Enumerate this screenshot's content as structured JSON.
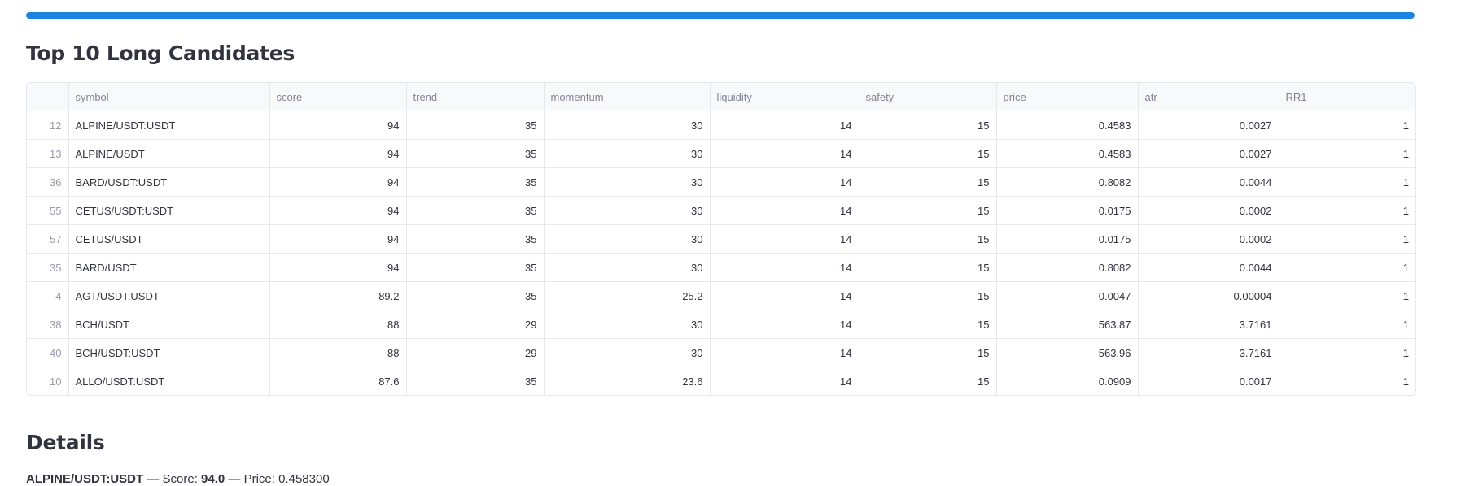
{
  "progress": {
    "fraction": 1.0,
    "color": "#1c83e1"
  },
  "top_section": {
    "title": "Top 10 Long Candidates"
  },
  "table": {
    "columns": [
      "",
      "symbol",
      "score",
      "trend",
      "momentum",
      "liquidity",
      "safety",
      "price",
      "atr",
      "RR1"
    ],
    "rows": [
      [
        "12",
        "ALPINE/USDT:USDT",
        "94",
        "35",
        "30",
        "14",
        "15",
        "0.4583",
        "0.0027",
        "1"
      ],
      [
        "13",
        "ALPINE/USDT",
        "94",
        "35",
        "30",
        "14",
        "15",
        "0.4583",
        "0.0027",
        "1"
      ],
      [
        "36",
        "BARD/USDT:USDT",
        "94",
        "35",
        "30",
        "14",
        "15",
        "0.8082",
        "0.0044",
        "1"
      ],
      [
        "55",
        "CETUS/USDT:USDT",
        "94",
        "35",
        "30",
        "14",
        "15",
        "0.0175",
        "0.0002",
        "1"
      ],
      [
        "57",
        "CETUS/USDT",
        "94",
        "35",
        "30",
        "14",
        "15",
        "0.0175",
        "0.0002",
        "1"
      ],
      [
        "35",
        "BARD/USDT",
        "94",
        "35",
        "30",
        "14",
        "15",
        "0.8082",
        "0.0044",
        "1"
      ],
      [
        "4",
        "AGT/USDT:USDT",
        "89.2",
        "35",
        "25.2",
        "14",
        "15",
        "0.0047",
        "0.00004",
        "1"
      ],
      [
        "38",
        "BCH/USDT",
        "88",
        "29",
        "30",
        "14",
        "15",
        "563.87",
        "3.7161",
        "1"
      ],
      [
        "40",
        "BCH/USDT:USDT",
        "88",
        "29",
        "30",
        "14",
        "15",
        "563.96",
        "3.7161",
        "1"
      ],
      [
        "10",
        "ALLO/USDT:USDT",
        "87.6",
        "35",
        "23.6",
        "14",
        "15",
        "0.0909",
        "0.0017",
        "1"
      ]
    ]
  },
  "details": {
    "title": "Details",
    "symbol": "ALPINE/USDT:USDT",
    "sep1": " — Score: ",
    "score": "94.0",
    "sep2": " — Price: ",
    "price": "0.458300"
  }
}
